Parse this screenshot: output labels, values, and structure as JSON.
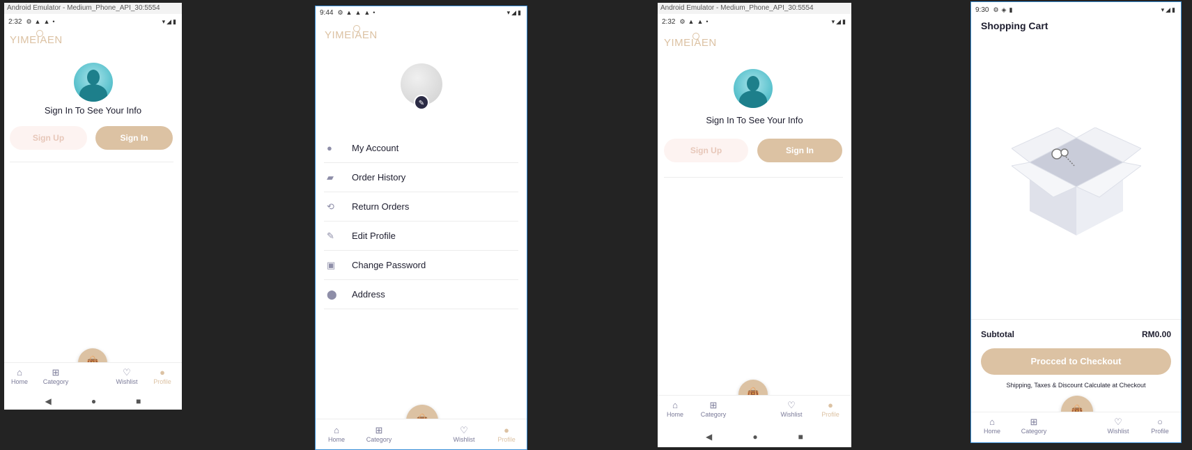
{
  "screens": {
    "s1": {
      "window_title": "Android Emulator - Medium_Phone_API_30:5554",
      "time": "2:32",
      "logo": "YIMEIAEN",
      "signin_prompt": "Sign In To See Your Info",
      "signup_label": "Sign Up",
      "signin_label": "Sign In"
    },
    "s2": {
      "time": "9:44",
      "logo": "YIMEIAEN",
      "menu": [
        {
          "label": "My Account",
          "icon": "person-icon"
        },
        {
          "label": "Order History",
          "icon": "bag-icon"
        },
        {
          "label": "Return Orders",
          "icon": "return-icon"
        },
        {
          "label": "Edit Profile",
          "icon": "pencil-icon"
        },
        {
          "label": "Change Password",
          "icon": "key-icon"
        },
        {
          "label": "Address",
          "icon": "location-icon"
        }
      ]
    },
    "s3": {
      "window_title": "Android Emulator - Medium_Phone_API_30:5554",
      "time": "2:32",
      "logo": "YIMEIAEN",
      "signin_prompt": "Sign In To See Your Info",
      "signup_label": "Sign Up",
      "signin_label": "Sign In"
    },
    "s4": {
      "time": "9:30",
      "title": "Shopping Cart",
      "subtotal_label": "Subtotal",
      "subtotal_value": "RM0.00",
      "checkout_label": "Procced to Checkout",
      "shipping_note": "Shipping, Taxes & Discount Calculate at Checkout"
    }
  },
  "nav": {
    "home": "Home",
    "category": "Category",
    "wishlist": "Wishlist",
    "profile": "Profile"
  },
  "colors": {
    "accent": "#dcc2a3",
    "text": "#1d1d2e",
    "nav_inactive": "#7a7a98",
    "signup_bg": "#fdf3f1"
  }
}
